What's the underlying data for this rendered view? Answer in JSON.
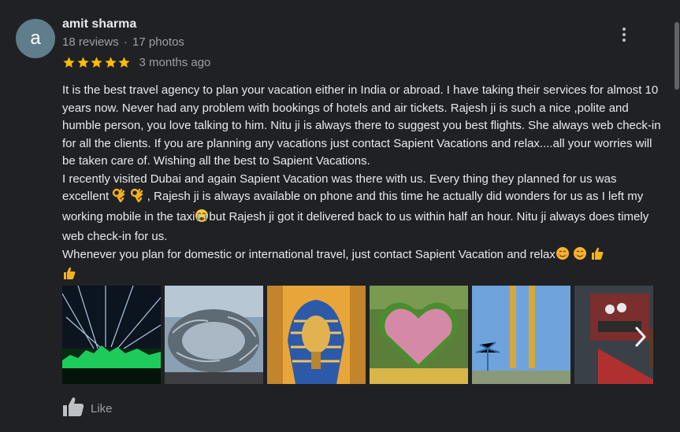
{
  "reviewer": {
    "avatar_letter": "a",
    "avatar_color": "#607d8b",
    "name": "amit sharma",
    "reviews": "18 reviews",
    "separator": "·",
    "photos": "17 photos"
  },
  "rating": {
    "stars": 5,
    "max": 5,
    "color": "#fbbc04",
    "time_ago": "3 months ago"
  },
  "review": {
    "p1": "It is the best travel agency to plan your vacation either in India or abroad. I have taking their services for almost 10 years now. Never had any problem with bookings of hotels and air tickets. Rajesh ji is such a nice ,polite and humble person, you love talking to him. Nitu ji is always there to suggest you best flights. She always web check-in for all the clients. If you are planning any vacations just contact Sapient Vacations and relax....all your worries will be taken care of. Wishing all the best to Sapient Vacations.",
    "p2a": "I recently visited Dubai and again Sapient Vacation was there with us. Every thing they planned for us was excellent ",
    "p2b": " , Rajesh ji is always available on phone and this time he actually did wonders for us as I left my working mobile in the taxi",
    "p2c": "but Rajesh ji got it delivered back to us within half an hour. Nitu ji always does timely web check-in for us.",
    "p3": "Whenever you plan for domestic or international travel, just contact Sapient Vacation and relax",
    "emoji": [
      "ok-hand",
      "ok-hand",
      "crying-face",
      "smiling-face",
      "smiling-face",
      "thumbs-up",
      "thumbs-up"
    ]
  },
  "photos": [
    {
      "name": "photo-night-light-show"
    },
    {
      "name": "photo-museum-of-the-future"
    },
    {
      "name": "photo-pharaoh-statue"
    },
    {
      "name": "photo-flower-heart"
    },
    {
      "name": "photo-dubai-frame"
    },
    {
      "name": "photo-welcome-abu-dhabi"
    }
  ],
  "icons": {
    "more": "more-vert-icon",
    "next": "chevron-right-icon",
    "like": "thumb-up-icon"
  },
  "actions": {
    "like_label": "Like"
  }
}
